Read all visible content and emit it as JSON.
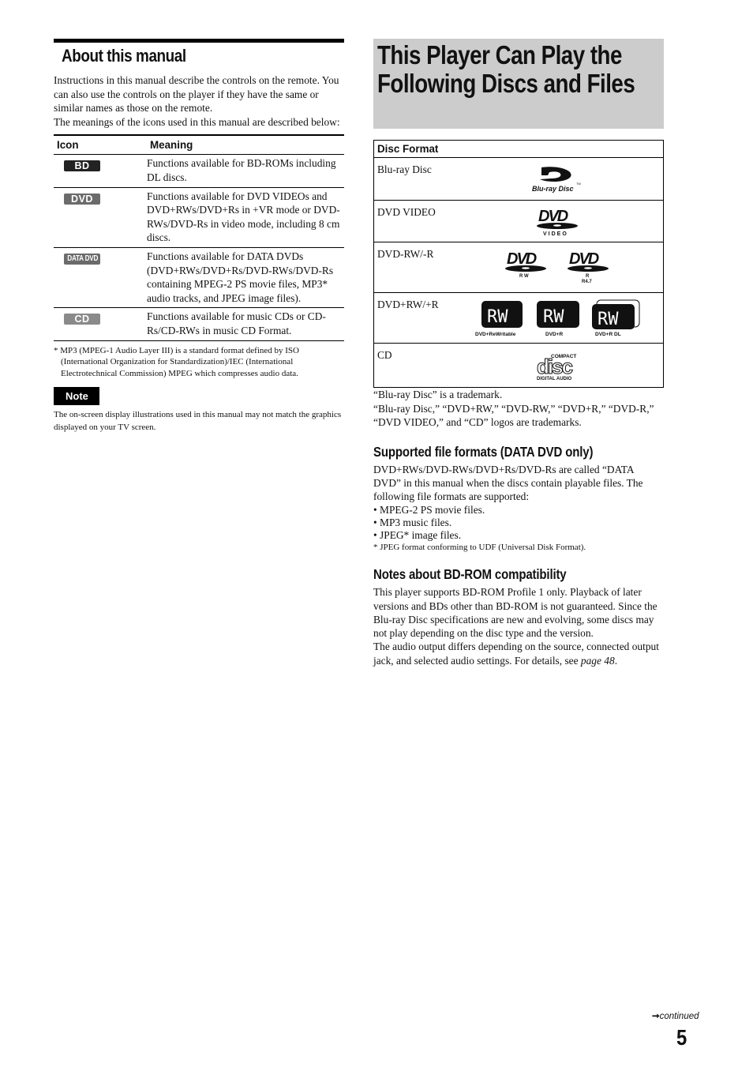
{
  "left": {
    "title": "About this manual",
    "intro": [
      "Instructions in this manual describe the controls on the remote. You can also use the controls on the player if they have the same or similar names as those on the remote.",
      "The meanings of the icons used in this manual are described below:"
    ],
    "icon_table": {
      "headers": {
        "icon": "Icon",
        "meaning": "Meaning"
      },
      "rows": [
        {
          "icon": "bd-badge-icon",
          "badge_text": "BD",
          "meaning": "Functions available for BD-ROMs including DL discs."
        },
        {
          "icon": "dvd-badge-icon",
          "badge_text": "DVD",
          "meaning": "Functions available for DVD VIDEOs and DVD+RWs/DVD+Rs in +VR mode or DVD-RWs/DVD-Rs in video mode, including 8 cm discs."
        },
        {
          "icon": "data-dvd-badge-icon",
          "badge_text": "DATA DVD",
          "meaning": "Functions available for DATA DVDs (DVD+RWs/DVD+Rs/DVD-RWs/DVD-Rs containing MPEG-2 PS movie files, MP3* audio tracks, and JPEG image files)."
        },
        {
          "icon": "cd-badge-icon",
          "badge_text": "CD",
          "meaning": "Functions available for music CDs or CD-Rs/CD-RWs in music CD Format."
        }
      ]
    },
    "footnote": "* MP3 (MPEG-1 Audio Layer III) is a standard format defined by ISO (International Organization for Standardization)/IEC (International Electrotechnical Commission) MPEG which compresses audio data.",
    "note_label": "Note",
    "note_text": "The on-screen display illustrations used in this manual may not match the graphics displayed on your TV screen."
  },
  "right": {
    "title_line1": "This Player Can Play the",
    "title_line2": "Following Discs and Files",
    "disc_table": {
      "header": "Disc Format",
      "rows": [
        {
          "label": "Blu-ray Disc",
          "logos": [
            {
              "icon": "blu-ray-disc-logo-icon",
              "caption": "Blu-ray Disc"
            }
          ]
        },
        {
          "label": "DVD VIDEO",
          "logos": [
            {
              "icon": "dvd-video-logo-icon",
              "caption": "VIDEO"
            }
          ]
        },
        {
          "label": "DVD-RW/-R",
          "logos": [
            {
              "icon": "dvd-rw-logo-icon",
              "caption": "R W"
            },
            {
              "icon": "dvd-r-logo-icon",
              "caption": "R",
              "caption2": "R4.7"
            }
          ]
        },
        {
          "label": "DVD+RW/+R",
          "logos": [
            {
              "icon": "dvd-plus-rewritable-logo-icon",
              "caption": "DVD+ReWritable"
            },
            {
              "icon": "dvd-plus-r-logo-icon",
              "caption": "DVD+R"
            },
            {
              "icon": "dvd-plus-r-dl-logo-icon",
              "caption": "DVD+R DL"
            }
          ]
        },
        {
          "label": "CD",
          "logos": [
            {
              "icon": "compact-disc-digital-audio-logo-icon",
              "caption_top": "COMPACT",
              "caption_mid": "disc",
              "caption_bottom": "DIGITAL AUDIO"
            }
          ]
        }
      ]
    },
    "trademark_notes": [
      "“Blu-ray Disc” is a trademark.",
      "“Blu-ray Disc,” “DVD+RW,” “DVD-RW,” “DVD+R,” “DVD-R,” “DVD VIDEO,” and “CD” logos are trademarks."
    ],
    "supported": {
      "title": "Supported file formats (DATA DVD only)",
      "intro": "DVD+RWs/DVD-RWs/DVD+Rs/DVD-Rs are called “DATA DVD” in this manual when the discs contain playable files. The following file formats are supported:",
      "bullets": [
        "• MPEG-2 PS movie files.",
        "• MP3 music files.",
        "• JPEG* image files."
      ],
      "footnote": "* JPEG format conforming to UDF (Universal Disk Format)."
    },
    "bdrom": {
      "title": "Notes about BD-ROM compatibility",
      "para1": "This player supports BD-ROM Profile 1 only. Playback of later versions and BDs other than BD-ROM is not guaranteed. Since the Blu-ray Disc specifications are new and evolving, some discs may not play depending on the disc type and the version.",
      "para2_prefix": "The audio output differs depending on the source, connected output jack, and selected audio settings. For details, see ",
      "para2_link": "page 48",
      "para2_suffix": "."
    }
  },
  "footer": {
    "continued_icon": "arrow-right-icon",
    "continued": "continued",
    "page_number": "5"
  }
}
